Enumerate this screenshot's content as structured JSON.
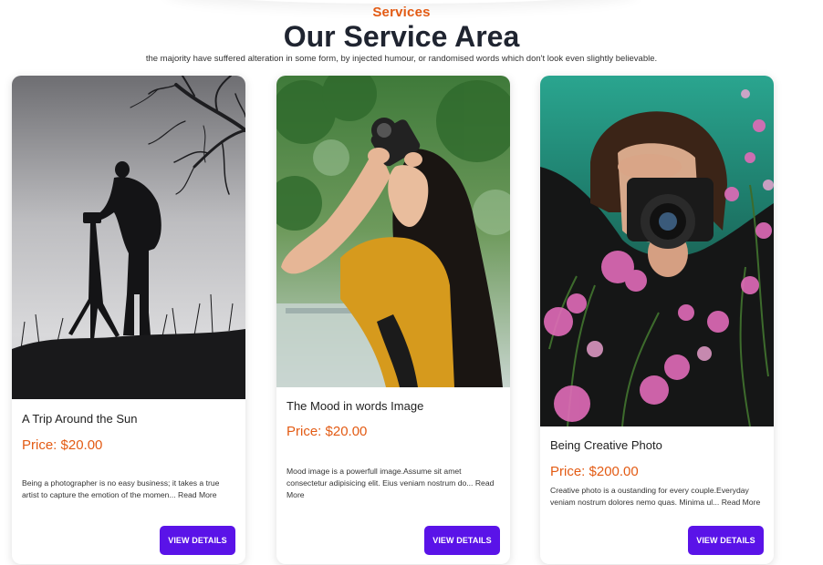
{
  "section": {
    "eyebrow": "Services",
    "title": "Our Service Area",
    "subtitle": "the majority have suffered alteration in some form, by injected humour, or randomised words which don't look even slightly believable."
  },
  "cards": [
    {
      "title": "A Trip Around the Sun",
      "price": "Price: $20.00",
      "description": "Being a photographer is no easy business; it takes a true artist to capture the emotion of the momen...",
      "read_more": "Read More",
      "button": "VIEW DETAILS",
      "image_icon": "photographer-silhouette-image"
    },
    {
      "title": "The Mood in words Image",
      "price": "Price: $20.00",
      "description": "Mood image is a powerfull image.Assume sit amet consectetur adipisicing elit. Eius veniam nostrum do...",
      "read_more": "Read More",
      "button": "VIEW DETAILS",
      "image_icon": "woman-with-camera-image"
    },
    {
      "title": "Being Creative Photo",
      "price": "Price: $200.00",
      "description": "Creative photo is a oustanding for every couple.Everyday veniam nostrum dolores nemo quas. Minima ul...",
      "read_more": "Read More",
      "button": "VIEW DETAILS",
      "image_icon": "photographer-behind-flowers-image"
    }
  ],
  "colors": {
    "accent": "#e35b14",
    "button": "#5a13e8",
    "heading": "#1f2430"
  }
}
